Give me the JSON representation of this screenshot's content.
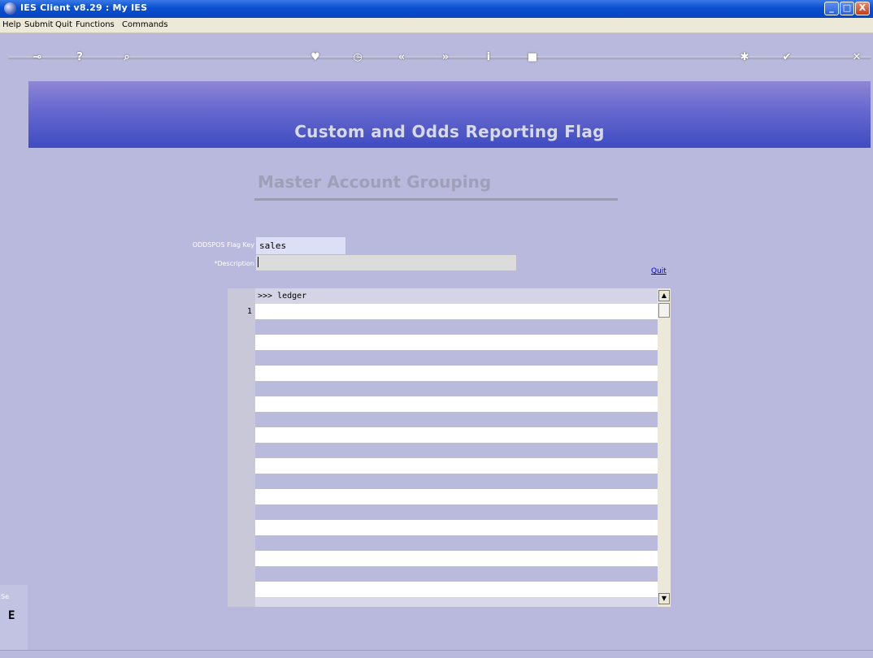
{
  "window": {
    "title": "IES Client v8.29 : My IES",
    "minimize": "_",
    "maximize": "□",
    "close": "X"
  },
  "menu": {
    "items": [
      "Help",
      "Submit",
      "Quit",
      "Functions",
      "Commands"
    ]
  },
  "toolbar": {
    "icons": [
      "key-icon",
      "help-icon",
      "search-icon",
      "heart-icon",
      "clock-icon",
      "rewind-icon",
      "fast-forward-icon",
      "info-icon",
      "stop-icon",
      "new-icon",
      "check-icon",
      "close-icon"
    ]
  },
  "banner": {
    "title": "Custom and Odds Reporting Flag"
  },
  "form": {
    "subtitle": "Master Account Grouping",
    "flag_key_label": "ODDSPOS Flag Key",
    "flag_key_value": "sales",
    "description_label": "*Description",
    "description_value": "",
    "quit_label": "Quit"
  },
  "grid": {
    "header": ">>> ledger",
    "rows": [
      {
        "num": "1",
        "value": ""
      }
    ],
    "scroll_up": "▲",
    "scroll_down": "▼"
  },
  "left_panel": {
    "label": "Se",
    "glyph": "E"
  },
  "colors": {
    "background": "#b9b9dd",
    "banner_top": "#8f86d4",
    "banner_bottom": "#3e4cc0",
    "link": "#0000cc"
  }
}
